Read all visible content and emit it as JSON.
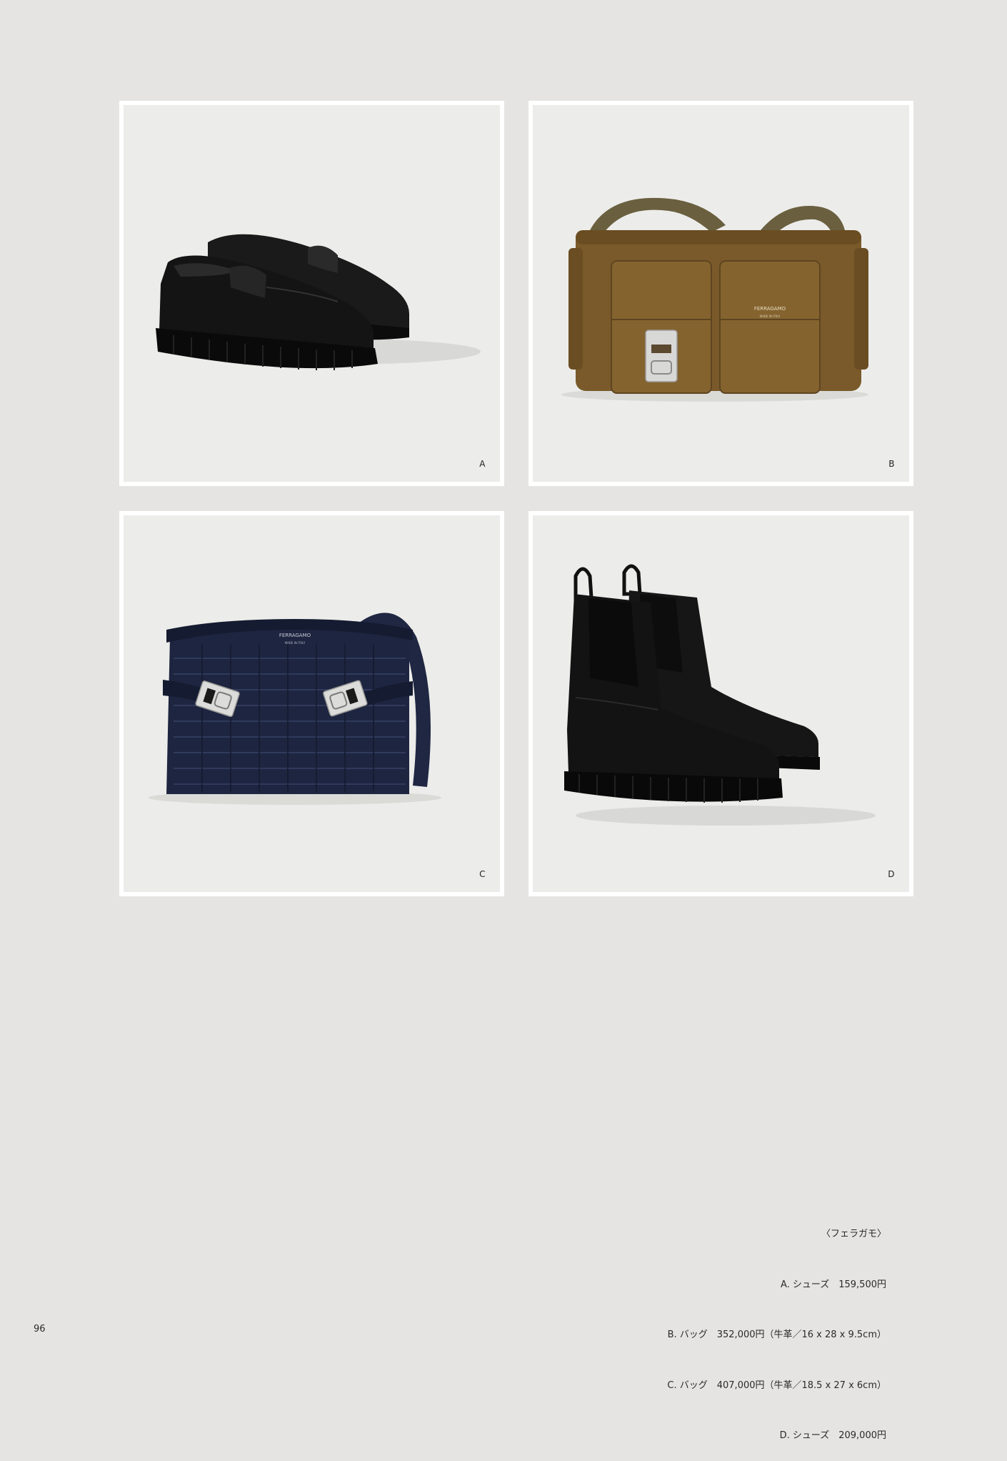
{
  "products": [
    {
      "id": "a",
      "letter": "A",
      "item": "loafers",
      "icon": "black-penny-loafers"
    },
    {
      "id": "b",
      "letter": "B",
      "item": "camera-bag",
      "icon": "olive-brown-leather-bag",
      "logo": "FERRAGAMO",
      "logo_sub": "MADE IN ITALY"
    },
    {
      "id": "c",
      "letter": "C",
      "item": "shoulder-bag",
      "icon": "navy-woven-shoulder-bag",
      "logo": "FERRAGAMO",
      "logo_sub": "MADE IN ITALY"
    },
    {
      "id": "d",
      "letter": "D",
      "item": "chelsea-boots",
      "icon": "black-chelsea-boots"
    }
  ],
  "credits": {
    "brand": "〈フェラガモ〉",
    "lines": [
      "A. シューズ　159,500円",
      "B. バッグ　352,000円（牛革／16 x 28 x 9.5cm）",
      "C. バッグ　407,000円（牛革／18.5 x 27 x 6cm）",
      "D. シューズ　209,000円"
    ]
  },
  "page_number": "96",
  "colors": {
    "page_bg": "#e5e4e2",
    "frame_border": "#ffffff",
    "frame_bg": "#ececea",
    "bag_b": "#7a5a2a",
    "bag_c": "#1e2540",
    "leather_black": "#141414"
  }
}
